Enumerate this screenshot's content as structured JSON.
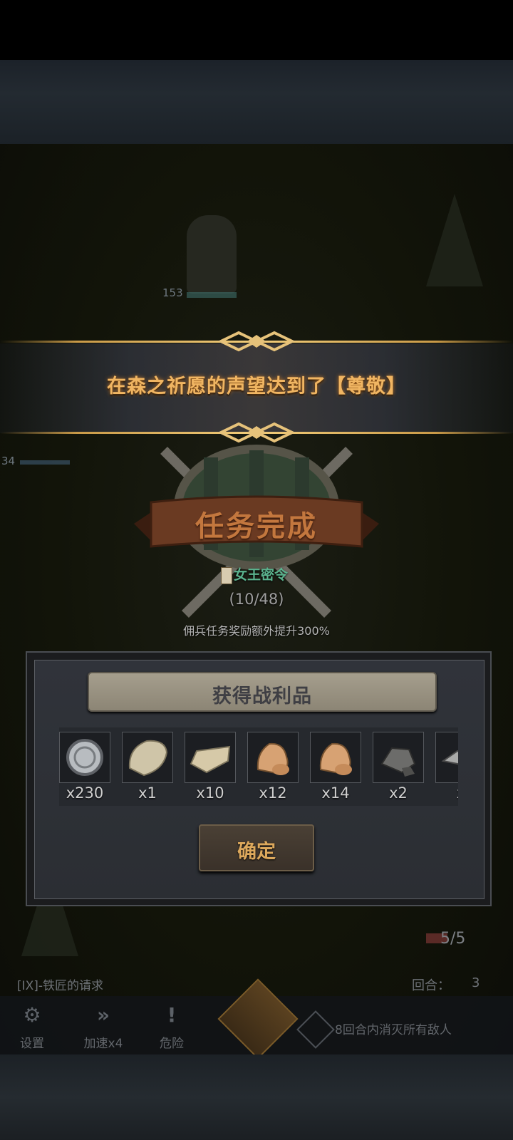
{
  "banner": {
    "text": "在森之祈愿的声望达到了【尊敬】"
  },
  "quest_complete": {
    "title": "任务完成",
    "order_name": "女王密令",
    "order_progress": "(10/48)",
    "bonus_text": "佣兵任务奖励额外提升300%"
  },
  "loot": {
    "title": "获得战利品",
    "items": [
      {
        "icon": "silver-coin-icon",
        "qty": "x230"
      },
      {
        "icon": "hide-icon",
        "qty": "x1"
      },
      {
        "icon": "fur-icon",
        "qty": "x10"
      },
      {
        "icon": "ore-icon",
        "qty": "x12"
      },
      {
        "icon": "ore-icon",
        "qty": "x14"
      },
      {
        "icon": "stone-icon",
        "qty": "x2"
      },
      {
        "icon": "ingot-icon",
        "qty": "x"
      }
    ],
    "confirm_label": "确定"
  },
  "battle": {
    "hero_hp": "153",
    "enemy_hp": "34",
    "turn_counter": "5/5",
    "quest_name": "[IX]-铁匠的请求",
    "round_label": "回合：",
    "round_value": "3",
    "settings_label": "设置",
    "speed_label": "加速x4",
    "danger_label": "危险",
    "objective": "8回合内消灭所有敌人"
  },
  "colors": {
    "banner_text": "#f0b562",
    "title": "#c3773e",
    "order": "#5bb38e",
    "confirm": "#dca85c"
  }
}
